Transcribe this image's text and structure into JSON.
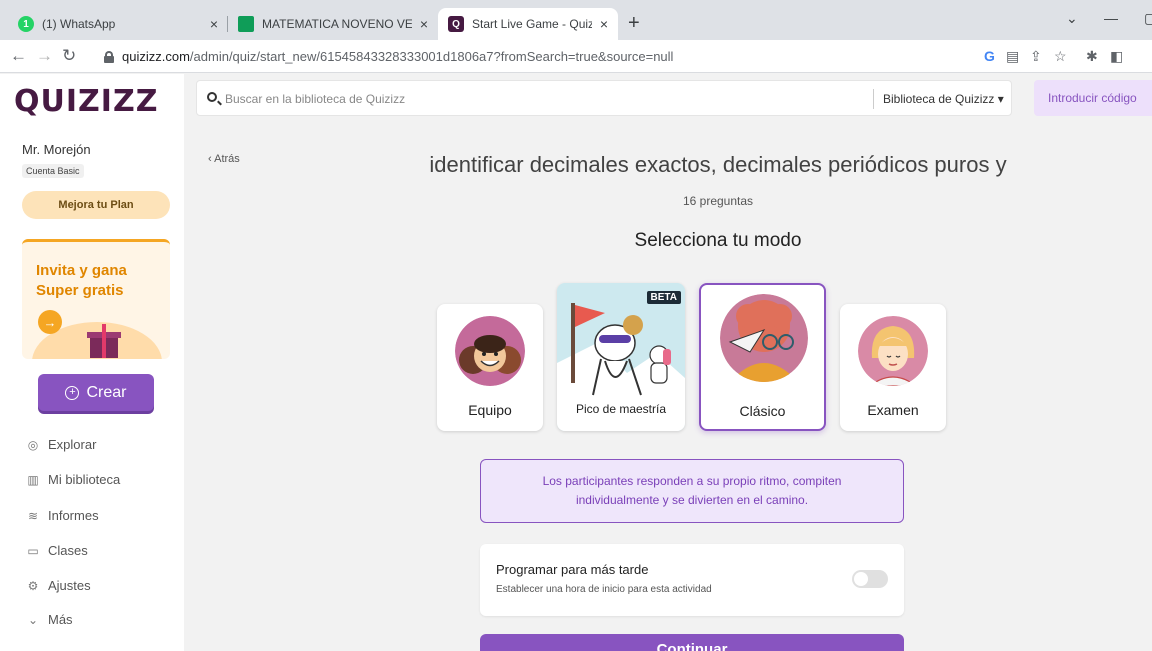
{
  "browser": {
    "tabs": [
      {
        "title": "(1) WhatsApp",
        "favicon": "whatsapp-icon",
        "color": "#25d366",
        "badge": "1"
      },
      {
        "title": "MATEMATICA NOVENO VESPERT",
        "favicon": "classroom-icon",
        "color": "#0f9d58"
      },
      {
        "title": "Start Live Game - Quizizz",
        "favicon": "quizizz-icon",
        "color": "#461a42"
      }
    ],
    "url_host": "quizizz.com",
    "url_path": "/admin/quiz/start_new/61545843328333001d1806a7?fromSearch=true&source=null"
  },
  "sidebar": {
    "logo": "QUIZIZZ",
    "user_name": "Mr. Morejón",
    "account_type": "Cuenta Basic",
    "upgrade_label": "Mejora tu Plan",
    "promo_line1": "Invita y gana",
    "promo_line2": "Super gratis",
    "create_label": "Crear",
    "nav": [
      {
        "label": "Explorar",
        "icon": "compass-icon"
      },
      {
        "label": "Mi biblioteca",
        "icon": "library-icon"
      },
      {
        "label": "Informes",
        "icon": "reports-icon"
      },
      {
        "label": "Clases",
        "icon": "classes-icon"
      },
      {
        "label": "Ajustes",
        "icon": "gear-icon"
      },
      {
        "label": "Más",
        "icon": "chevron-down-icon"
      }
    ]
  },
  "header": {
    "search_placeholder": "Buscar en la biblioteca de Quizizz",
    "library_select": "Biblioteca de Quizizz",
    "enter_code": "Introducir código"
  },
  "main": {
    "back_label": "Atrás",
    "quiz_title": "identificar decimales exactos, decimales periódicos puros y",
    "question_count": "16 preguntas",
    "mode_heading": "Selecciona tu modo",
    "modes": [
      {
        "label": "Equipo",
        "selected": false
      },
      {
        "label": "Pico de maestría",
        "selected": false,
        "badge": "BETA"
      },
      {
        "label": "Clásico",
        "selected": true
      },
      {
        "label": "Examen",
        "selected": false
      }
    ],
    "description_line1": "Los participantes responden a su propio ritmo, compiten",
    "description_line2": "individualmente y se divierten en el camino.",
    "schedule_title": "Programar para más tarde",
    "schedule_subtitle": "Establecer una hora de inicio para esta actividad",
    "schedule_enabled": false,
    "continue_label": "Continuar"
  },
  "colors": {
    "accent": "#8854c0",
    "brand": "#461a42"
  }
}
